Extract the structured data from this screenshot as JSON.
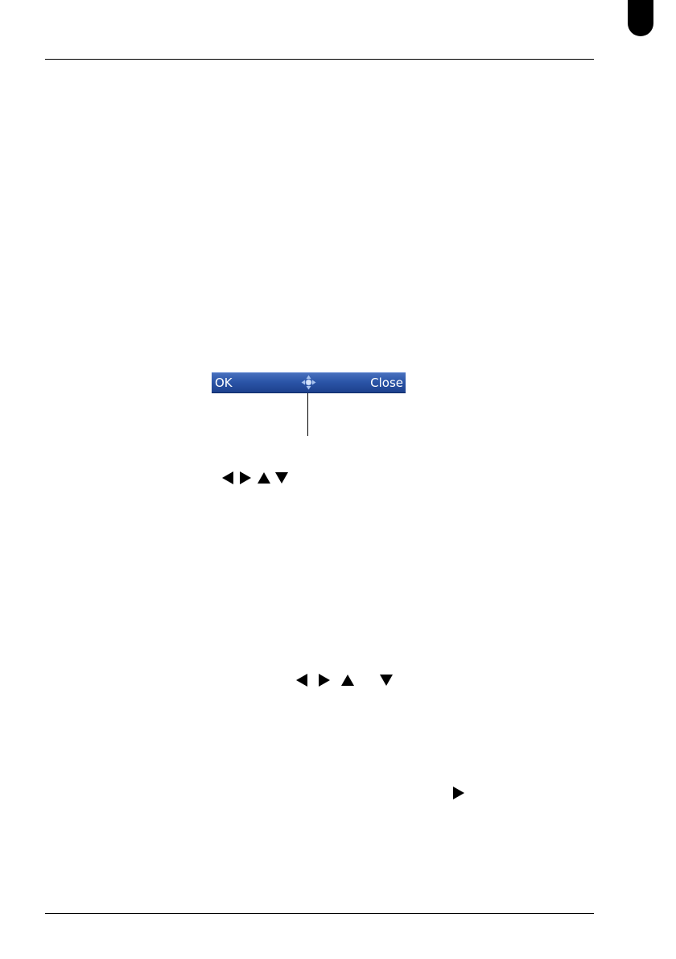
{
  "softkey_bar": {
    "left_label": "OK",
    "right_label": "Close",
    "center_icon": "navigation-4way-icon"
  },
  "icons": {
    "arrow_row_1": [
      "left-arrow-icon",
      "right-arrow-icon",
      "up-arrow-icon",
      "down-arrow-icon"
    ],
    "arrow_row_2": [
      "left-arrow-icon",
      "right-arrow-icon",
      "up-arrow-icon",
      "down-arrow-icon"
    ],
    "arrow_single": "right-arrow-icon"
  },
  "colors": {
    "softkey_bar_top": "#4a72bf",
    "softkey_bar_bottom": "#1c3f8a",
    "softkey_text": "#ffffff",
    "nav_icon": "#a9c4f0"
  }
}
